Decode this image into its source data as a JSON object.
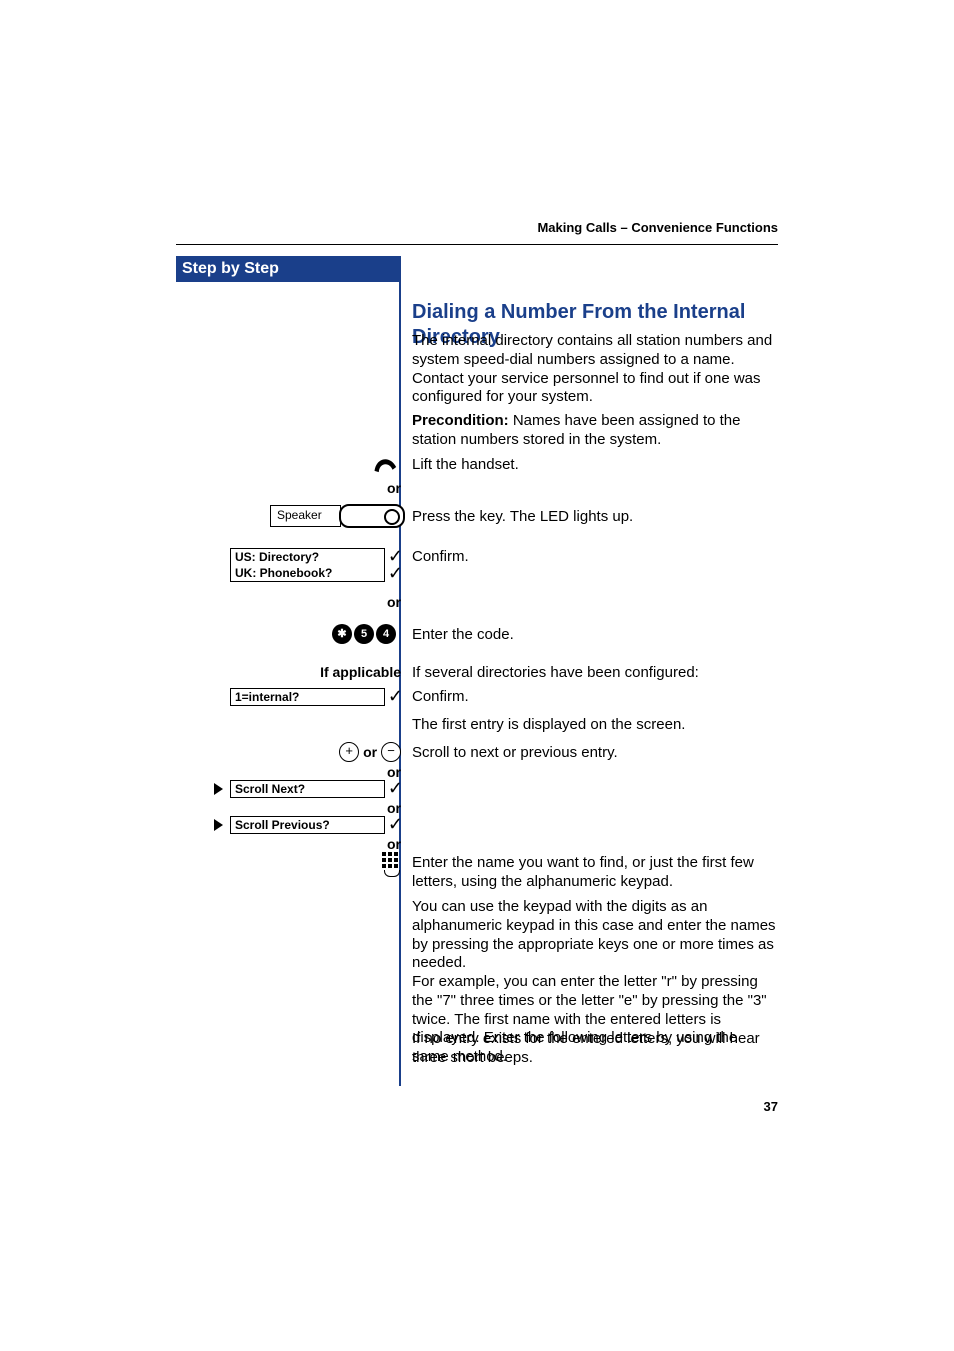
{
  "running_head": "Making Calls – Convenience Functions",
  "sidebar_header": "Step by Step",
  "section_title": "Dialing a Number From the Internal Directory",
  "intro": "The internal directory contains all station numbers and system speed-dial numbers assigned to a name. Contact your service personnel to find out if one was configured for your system.",
  "precondition_label": "Precondition:",
  "precondition_text": " Names have been assigned to the station numbers stored in the system.",
  "lift_handset": "Lift the handset.",
  "or": "or",
  "speaker_label": "Speaker",
  "press_key": "Press the key. The LED lights up.",
  "display": {
    "us": "US: Directory?",
    "uk": "UK: Phonebook?",
    "internal": "1=internal?",
    "scroll_next": "Scroll Next?",
    "scroll_prev": "Scroll Previous?"
  },
  "confirm": "Confirm.",
  "code": {
    "d1": "✱",
    "d2": "5",
    "d3": "4"
  },
  "enter_code": "Enter the code.",
  "if_applicable": "If applicable",
  "if_several": "If several directories have been configured:",
  "first_entry": "The first entry is displayed on the screen.",
  "scroll_instr": "Scroll to next or previous entry.",
  "enter_name": "Enter the name you want to find, or just the first few letters, using the alphanumeric keypad.",
  "keypad_para": "You can use the keypad with the digits as an alphanumeric keypad in this case and enter the names by pressing the appropriate keys one or more times as needed.\nFor example, you can enter the letter \"r\" by pressing the \"7\" three times or the letter \"e\" by pressing the \"3\" twice. The first name with the entered letters is displayed. Enter the following letters by using the same method.",
  "no_entry": "If no entry exists for the entered letters, you will hear three short beeps.",
  "page_number": "37"
}
